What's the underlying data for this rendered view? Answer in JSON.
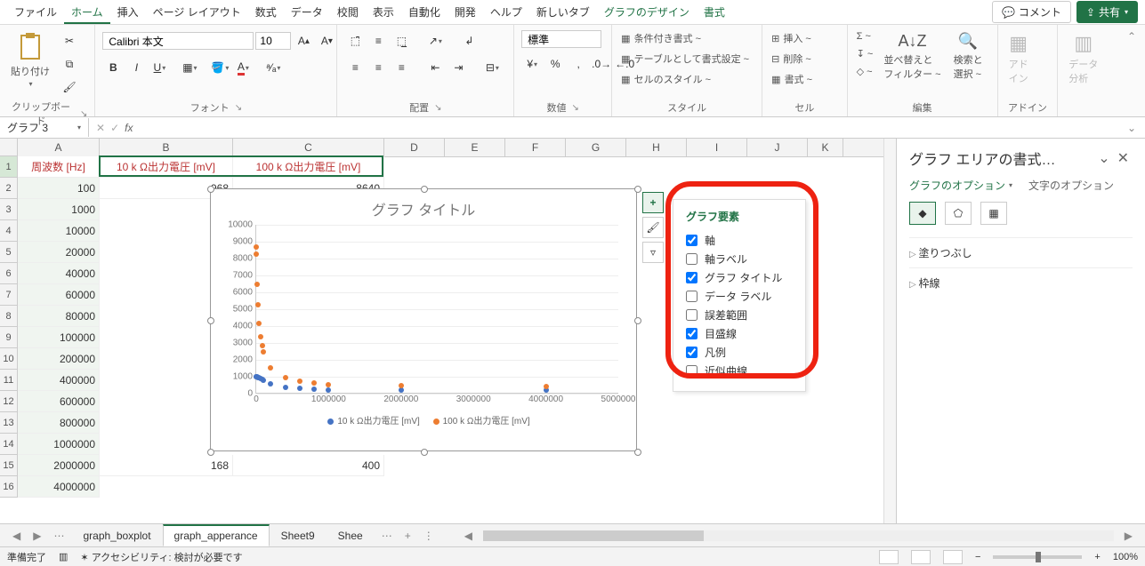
{
  "menu": {
    "items": [
      "ファイル",
      "ホーム",
      "挿入",
      "ページ レイアウト",
      "数式",
      "データ",
      "校閲",
      "表示",
      "自動化",
      "開発",
      "ヘルプ",
      "新しいタブ",
      "グラフのデザイン",
      "書式"
    ],
    "active_index": 1,
    "green_indices": [
      12,
      13
    ],
    "comment": "コメント",
    "share": "共有"
  },
  "ribbon": {
    "clipboard": {
      "label": "クリップボード",
      "paste": "貼り付け"
    },
    "font": {
      "label": "フォント",
      "font_name": "Calibri 本文",
      "font_size": "10"
    },
    "align": {
      "label": "配置"
    },
    "number": {
      "label": "数値",
      "format": "標準"
    },
    "styles": {
      "label": "スタイル",
      "conditional": "条件付き書式 ~",
      "table_fmt": "テーブルとして書式設定 ~",
      "cell_styles": "セルのスタイル ~"
    },
    "cells": {
      "label": "セル",
      "insert": "挿入 ~",
      "delete": "削除 ~",
      "format": "書式 ~"
    },
    "editing": {
      "label": "編集",
      "sort": "並べ替えと\nフィルター ~",
      "find": "検索と\n選択 ~"
    },
    "addin": {
      "label": "アドイン",
      "addin": "アド\nイン"
    },
    "analysis": {
      "label": "",
      "analysis": "データ\n分析"
    }
  },
  "namebox": "グラフ 3",
  "columns": [
    {
      "id": "A",
      "w": 92
    },
    {
      "id": "B",
      "w": 150
    },
    {
      "id": "C",
      "w": 170
    },
    {
      "id": "D",
      "w": 68
    },
    {
      "id": "E",
      "w": 68
    },
    {
      "id": "F",
      "w": 68
    },
    {
      "id": "G",
      "w": 68
    },
    {
      "id": "H",
      "w": 68
    },
    {
      "id": "I",
      "w": 68
    },
    {
      "id": "J",
      "w": 68
    },
    {
      "id": "K",
      "w": 40
    }
  ],
  "headers": [
    "周波数 [Hz]",
    "10 k Ω出力電圧 [mV]",
    "100 k Ω出力電圧 [mV]"
  ],
  "rows_data": [
    [
      "100",
      "968",
      "8640"
    ],
    [
      "1000",
      "",
      ""
    ],
    [
      "10000",
      "",
      ""
    ],
    [
      "20000",
      "",
      ""
    ],
    [
      "40000",
      "",
      ""
    ],
    [
      "60000",
      "",
      ""
    ],
    [
      "80000",
      "",
      ""
    ],
    [
      "100000",
      "",
      ""
    ],
    [
      "200000",
      "",
      ""
    ],
    [
      "400000",
      "",
      ""
    ],
    [
      "600000",
      "",
      ""
    ],
    [
      "800000",
      "",
      ""
    ],
    [
      "1000000",
      "",
      ""
    ],
    [
      "2000000",
      "168",
      "400"
    ],
    [
      "4000000",
      "",
      ""
    ]
  ],
  "chart": {
    "title": "グラフ タイトル",
    "y_ticks": [
      0,
      1000,
      2000,
      3000,
      4000,
      5000,
      6000,
      7000,
      8000,
      9000,
      10000
    ],
    "x_ticks": [
      0,
      1000000,
      2000000,
      3000000,
      4000000,
      5000000
    ],
    "legend": [
      "10 k Ω出力電圧 [mV]",
      "100 k Ω出力電圧 [mV]"
    ]
  },
  "chart_data": {
    "type": "scatter",
    "xlabel": "",
    "ylabel": "",
    "xlim": [
      0,
      5000000
    ],
    "ylim": [
      0,
      10000
    ],
    "x": [
      100,
      1000,
      10000,
      20000,
      40000,
      60000,
      80000,
      100000,
      200000,
      400000,
      600000,
      800000,
      1000000,
      2000000,
      4000000
    ],
    "series": [
      {
        "name": "10 k Ω出力電圧 [mV]",
        "color": "#4573c4",
        "values": [
          968,
          960,
          940,
          920,
          880,
          830,
          780,
          730,
          520,
          320,
          240,
          200,
          180,
          168,
          150
        ]
      },
      {
        "name": "100 k Ω出力電圧 [mV]",
        "color": "#ed7d31",
        "values": [
          8640,
          8200,
          6400,
          5200,
          4100,
          3300,
          2800,
          2400,
          1500,
          900,
          700,
          560,
          480,
          400,
          360
        ]
      }
    ]
  },
  "chart_elements": {
    "title": "グラフ要素",
    "items": [
      {
        "label": "軸",
        "checked": true
      },
      {
        "label": "軸ラベル",
        "checked": false
      },
      {
        "label": "グラフ タイトル",
        "checked": true
      },
      {
        "label": "データ ラベル",
        "checked": false
      },
      {
        "label": "誤差範囲",
        "checked": false
      },
      {
        "label": "目盛線",
        "checked": true
      },
      {
        "label": "凡例",
        "checked": true
      },
      {
        "label": "近似曲線",
        "checked": false
      }
    ]
  },
  "side_panel": {
    "title": "グラフ エリアの書式…",
    "tab1": "グラフのオプション",
    "tab2": "文字のオプション",
    "sections": [
      "塗りつぶし",
      "枠線"
    ]
  },
  "sheet_tabs": {
    "tabs": [
      "graph_boxplot",
      "graph_apperance",
      "Sheet9",
      "Shee"
    ],
    "active_index": 1
  },
  "status": {
    "ready": "準備完了",
    "accessibility": "アクセシビリティ: 検討が必要です",
    "zoom": "100%"
  }
}
